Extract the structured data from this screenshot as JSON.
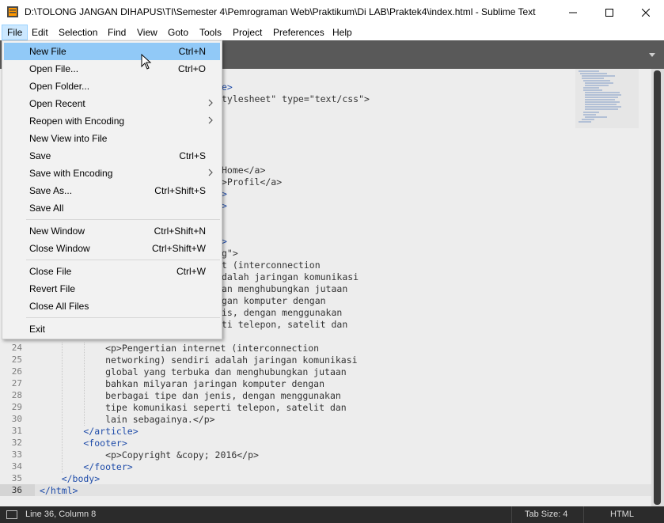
{
  "window": {
    "title": "D:\\TOLONG JANGAN DIHAPUS\\TI\\Semester 4\\Pemrograman Web\\Praktikum\\Di LAB\\Praktek4\\index.html - Sublime Text",
    "controls": [
      "minimize-icon",
      "maximize-icon",
      "close-icon"
    ]
  },
  "menubar": {
    "items": [
      "File",
      "Edit",
      "Selection",
      "Find",
      "View",
      "Goto",
      "Tools",
      "Project",
      "Preferences",
      "Help"
    ],
    "active": "File"
  },
  "file_menu": {
    "items": [
      {
        "label": "New File",
        "shortcut": "Ctrl+N",
        "highlighted": true
      },
      {
        "label": "Open File...",
        "shortcut": "Ctrl+O"
      },
      {
        "label": "Open Folder...",
        "shortcut": ""
      },
      {
        "label": "Open Recent",
        "shortcut": "",
        "submenu": true
      },
      {
        "label": "Reopen with Encoding",
        "shortcut": "",
        "submenu": true
      },
      {
        "label": "New View into File",
        "shortcut": ""
      },
      {
        "label": "Save",
        "shortcut": "Ctrl+S"
      },
      {
        "label": "Save with Encoding",
        "shortcut": "",
        "submenu": true
      },
      {
        "label": "Save As...",
        "shortcut": "Ctrl+Shift+S"
      },
      {
        "label": "Save All",
        "shortcut": ""
      },
      {
        "label": "New Window",
        "shortcut": "Ctrl+Shift+N"
      },
      {
        "label": "Close Window",
        "shortcut": "Ctrl+Shift+W"
      },
      {
        "label": "Close File",
        "shortcut": "Ctrl+W"
      },
      {
        "label": "Revert File",
        "shortcut": ""
      },
      {
        "label": "Close All Files",
        "shortcut": ""
      },
      {
        "label": "Exit",
        "shortcut": ""
      }
    ]
  },
  "editor": {
    "visible_fragments": [
      "e>",
      "tylesheet\" type=\"text/css\">",
      "Home</a>",
      ">Profil</a>",
      ">",
      ">",
      ">",
      "g\">",
      "t (interconnection",
      "dalah jaringan komunikasi",
      "an menghubungkan jutaan",
      "gan komputer dengan",
      "is, dengan menggunakan",
      "ti telepon, satelit dan"
    ],
    "lines": [
      {
        "n": "24",
        "text": "            <p>Pengertian internet (interconnection"
      },
      {
        "n": "25",
        "text": "            networking) sendiri adalah jaringan komunikasi"
      },
      {
        "n": "26",
        "text": "            global yang terbuka dan menghubungkan jutaan"
      },
      {
        "n": "27",
        "text": "            bahkan milyaran jaringan komputer dengan"
      },
      {
        "n": "28",
        "text": "            berbagai tipe dan jenis, dengan menggunakan"
      },
      {
        "n": "29",
        "text": "            tipe komunikasi seperti telepon, satelit dan"
      },
      {
        "n": "30",
        "text": "            lain sebagainya.</p>"
      },
      {
        "n": "31",
        "text": "        </article>"
      },
      {
        "n": "32",
        "text": "        <footer>"
      },
      {
        "n": "33",
        "text": "            <p>Copyright &copy; 2016</p>"
      },
      {
        "n": "34",
        "text": "        </footer>"
      },
      {
        "n": "35",
        "text": "    </body>"
      },
      {
        "n": "36",
        "text": "</html>"
      }
    ],
    "active_line": "36"
  },
  "status": {
    "position": "Line 36, Column 8",
    "tab_size": "Tab Size: 4",
    "syntax": "HTML"
  }
}
